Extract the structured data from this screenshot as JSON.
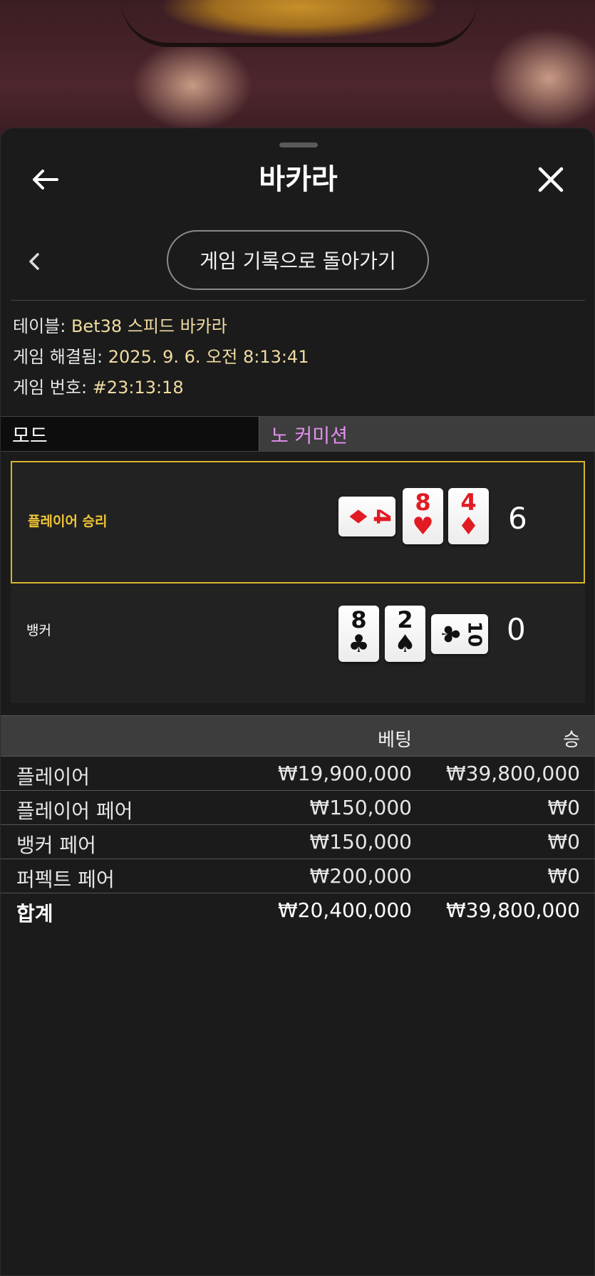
{
  "header": {
    "title": "바카라"
  },
  "nav": {
    "back_to_history": "게임 기록으로 돌아가기"
  },
  "info": {
    "table_label": "테이블:",
    "table_value": "Bet38 스피드 바카라",
    "resolved_label": "게임 해결됨:",
    "resolved_value": "2025. 9. 6. 오전 8:13:41",
    "game_no_label": "게임 번호:",
    "game_no_value": "#23:13:18"
  },
  "mode": {
    "label": "모드",
    "value": "노 커미션"
  },
  "hands": {
    "player": {
      "label": "플레이어 승리",
      "score": "6",
      "cards": [
        {
          "rank": "4",
          "suit": "♦",
          "color": "red",
          "rotated": true
        },
        {
          "rank": "8",
          "suit": "♥",
          "color": "red",
          "rotated": false
        },
        {
          "rank": "4",
          "suit": "♦",
          "color": "red",
          "rotated": false
        }
      ]
    },
    "banker": {
      "label": "뱅커",
      "score": "0",
      "cards": [
        {
          "rank": "8",
          "suit": "♣",
          "color": "black",
          "rotated": false
        },
        {
          "rank": "2",
          "suit": "♠",
          "color": "black",
          "rotated": false
        },
        {
          "rank": "10",
          "suit": "♣",
          "color": "black",
          "rotated": true
        }
      ]
    }
  },
  "bets": {
    "col_bet": "베팅",
    "col_win": "승",
    "rows": [
      {
        "name": "플레이어",
        "bet": "₩19,900,000",
        "win": "₩39,800,000"
      },
      {
        "name": "플레이어 페어",
        "bet": "₩150,000",
        "win": "₩0"
      },
      {
        "name": "뱅커 페어",
        "bet": "₩150,000",
        "win": "₩0"
      },
      {
        "name": "퍼펙트 페어",
        "bet": "₩200,000",
        "win": "₩0"
      }
    ],
    "total": {
      "name": "합계",
      "bet": "₩20,400,000",
      "win": "₩39,800,000"
    }
  },
  "colors": {
    "accent_gold": "#d8b52b",
    "mode_value": "#e490f0",
    "info_value": "#f0dca2"
  }
}
